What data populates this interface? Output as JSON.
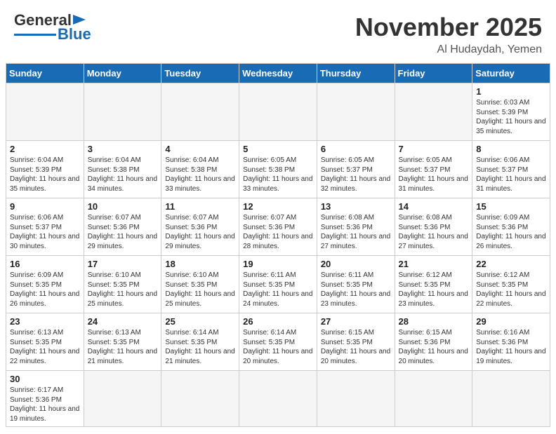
{
  "header": {
    "logo_general": "General",
    "logo_blue": "Blue",
    "month_year": "November 2025",
    "location": "Al Hudaydah, Yemen"
  },
  "days_of_week": [
    "Sunday",
    "Monday",
    "Tuesday",
    "Wednesday",
    "Thursday",
    "Friday",
    "Saturday"
  ],
  "weeks": [
    [
      {
        "day": "",
        "info": ""
      },
      {
        "day": "",
        "info": ""
      },
      {
        "day": "",
        "info": ""
      },
      {
        "day": "",
        "info": ""
      },
      {
        "day": "",
        "info": ""
      },
      {
        "day": "",
        "info": ""
      },
      {
        "day": "1",
        "info": "Sunrise: 6:03 AM\nSunset: 5:39 PM\nDaylight: 11 hours and 35 minutes."
      }
    ],
    [
      {
        "day": "2",
        "info": "Sunrise: 6:04 AM\nSunset: 5:39 PM\nDaylight: 11 hours and 35 minutes."
      },
      {
        "day": "3",
        "info": "Sunrise: 6:04 AM\nSunset: 5:38 PM\nDaylight: 11 hours and 34 minutes."
      },
      {
        "day": "4",
        "info": "Sunrise: 6:04 AM\nSunset: 5:38 PM\nDaylight: 11 hours and 33 minutes."
      },
      {
        "day": "5",
        "info": "Sunrise: 6:05 AM\nSunset: 5:38 PM\nDaylight: 11 hours and 33 minutes."
      },
      {
        "day": "6",
        "info": "Sunrise: 6:05 AM\nSunset: 5:37 PM\nDaylight: 11 hours and 32 minutes."
      },
      {
        "day": "7",
        "info": "Sunrise: 6:05 AM\nSunset: 5:37 PM\nDaylight: 11 hours and 31 minutes."
      },
      {
        "day": "8",
        "info": "Sunrise: 6:06 AM\nSunset: 5:37 PM\nDaylight: 11 hours and 31 minutes."
      }
    ],
    [
      {
        "day": "9",
        "info": "Sunrise: 6:06 AM\nSunset: 5:37 PM\nDaylight: 11 hours and 30 minutes."
      },
      {
        "day": "10",
        "info": "Sunrise: 6:07 AM\nSunset: 5:36 PM\nDaylight: 11 hours and 29 minutes."
      },
      {
        "day": "11",
        "info": "Sunrise: 6:07 AM\nSunset: 5:36 PM\nDaylight: 11 hours and 29 minutes."
      },
      {
        "day": "12",
        "info": "Sunrise: 6:07 AM\nSunset: 5:36 PM\nDaylight: 11 hours and 28 minutes."
      },
      {
        "day": "13",
        "info": "Sunrise: 6:08 AM\nSunset: 5:36 PM\nDaylight: 11 hours and 27 minutes."
      },
      {
        "day": "14",
        "info": "Sunrise: 6:08 AM\nSunset: 5:36 PM\nDaylight: 11 hours and 27 minutes."
      },
      {
        "day": "15",
        "info": "Sunrise: 6:09 AM\nSunset: 5:36 PM\nDaylight: 11 hours and 26 minutes."
      }
    ],
    [
      {
        "day": "16",
        "info": "Sunrise: 6:09 AM\nSunset: 5:35 PM\nDaylight: 11 hours and 26 minutes."
      },
      {
        "day": "17",
        "info": "Sunrise: 6:10 AM\nSunset: 5:35 PM\nDaylight: 11 hours and 25 minutes."
      },
      {
        "day": "18",
        "info": "Sunrise: 6:10 AM\nSunset: 5:35 PM\nDaylight: 11 hours and 25 minutes."
      },
      {
        "day": "19",
        "info": "Sunrise: 6:11 AM\nSunset: 5:35 PM\nDaylight: 11 hours and 24 minutes."
      },
      {
        "day": "20",
        "info": "Sunrise: 6:11 AM\nSunset: 5:35 PM\nDaylight: 11 hours and 23 minutes."
      },
      {
        "day": "21",
        "info": "Sunrise: 6:12 AM\nSunset: 5:35 PM\nDaylight: 11 hours and 23 minutes."
      },
      {
        "day": "22",
        "info": "Sunrise: 6:12 AM\nSunset: 5:35 PM\nDaylight: 11 hours and 22 minutes."
      }
    ],
    [
      {
        "day": "23",
        "info": "Sunrise: 6:13 AM\nSunset: 5:35 PM\nDaylight: 11 hours and 22 minutes."
      },
      {
        "day": "24",
        "info": "Sunrise: 6:13 AM\nSunset: 5:35 PM\nDaylight: 11 hours and 21 minutes."
      },
      {
        "day": "25",
        "info": "Sunrise: 6:14 AM\nSunset: 5:35 PM\nDaylight: 11 hours and 21 minutes."
      },
      {
        "day": "26",
        "info": "Sunrise: 6:14 AM\nSunset: 5:35 PM\nDaylight: 11 hours and 20 minutes."
      },
      {
        "day": "27",
        "info": "Sunrise: 6:15 AM\nSunset: 5:35 PM\nDaylight: 11 hours and 20 minutes."
      },
      {
        "day": "28",
        "info": "Sunrise: 6:15 AM\nSunset: 5:36 PM\nDaylight: 11 hours and 20 minutes."
      },
      {
        "day": "29",
        "info": "Sunrise: 6:16 AM\nSunset: 5:36 PM\nDaylight: 11 hours and 19 minutes."
      }
    ],
    [
      {
        "day": "30",
        "info": "Sunrise: 6:17 AM\nSunset: 5:36 PM\nDaylight: 11 hours and 19 minutes."
      },
      {
        "day": "",
        "info": ""
      },
      {
        "day": "",
        "info": ""
      },
      {
        "day": "",
        "info": ""
      },
      {
        "day": "",
        "info": ""
      },
      {
        "day": "",
        "info": ""
      },
      {
        "day": "",
        "info": ""
      }
    ]
  ]
}
